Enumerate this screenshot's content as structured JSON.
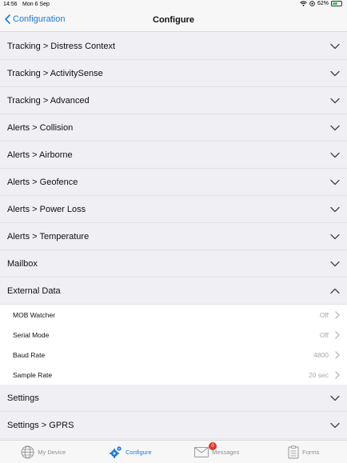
{
  "status": {
    "time": "14:56",
    "date": "Mon 6 Sep",
    "battery": "62%",
    "battery_level": 0.62
  },
  "nav": {
    "back_label": "Configuration",
    "title": "Configure"
  },
  "sections_top": [
    {
      "label": "Tracking > Distress Context"
    },
    {
      "label": "Tracking > ActivitySense"
    },
    {
      "label": "Tracking > Advanced"
    },
    {
      "label": "Alerts > Collision"
    },
    {
      "label": "Alerts > Airborne"
    },
    {
      "label": "Alerts > Geofence"
    },
    {
      "label": "Alerts > Power Loss"
    },
    {
      "label": "Alerts > Temperature"
    },
    {
      "label": "Mailbox"
    }
  ],
  "expanded_section": {
    "label": "External Data",
    "items": [
      {
        "label": "MOB Watcher",
        "value": "Off"
      },
      {
        "label": "Serial Mode",
        "value": "Off"
      },
      {
        "label": "Baud Rate",
        "value": "4800"
      },
      {
        "label": "Sample Rate",
        "value": "20 sec"
      }
    ]
  },
  "sections_bottom": [
    {
      "label": "Settings"
    },
    {
      "label": "Settings > GPRS"
    }
  ],
  "tabs": [
    {
      "label": "My Device",
      "icon": "globe-icon"
    },
    {
      "label": "Configure",
      "icon": "gear-icon",
      "active": true
    },
    {
      "label": "Messages",
      "icon": "envelope-icon",
      "badge": "0"
    },
    {
      "label": "Forms",
      "icon": "clipboard-icon"
    }
  ],
  "colors": {
    "accent": "#1a7bdc",
    "badge": "#e5332a",
    "battery": "#34c759"
  }
}
